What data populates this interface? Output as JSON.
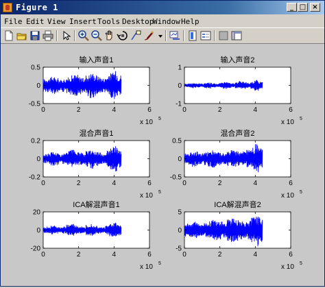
{
  "window": {
    "title": "Figure 1",
    "minimize_glyph": "_",
    "maximize_glyph": "□",
    "close_glyph": "×"
  },
  "menu": [
    "File",
    "Edit",
    "View",
    "Insert",
    "Tools",
    "Desktop",
    "Window",
    "Help"
  ],
  "toolbar": {
    "icons": [
      "new-figure-icon",
      "open-file-icon",
      "save-icon",
      "print-icon",
      "edit-plot-arrow-icon",
      "zoom-in-icon",
      "zoom-out-icon",
      "pan-icon",
      "rotate-3d-icon",
      "data-cursor-icon",
      "brush-icon",
      "link-plot-icon",
      "colorbar-icon",
      "legend-icon",
      "hide-plot-tools-icon",
      "show-plot-tools-icon"
    ]
  },
  "colors": {
    "signal": "#0000ff",
    "axes_bg": "#ffffff",
    "figure_bg": "#c8c8c8"
  },
  "chart_data": [
    {
      "type": "line",
      "title": "输入声音1",
      "xlim": [
        0,
        6
      ],
      "ylim": [
        -0.5,
        0.5
      ],
      "xticks": [
        "0",
        "2",
        "4",
        "6"
      ],
      "yticks": [
        "-0.5",
        "0",
        "0.5"
      ],
      "x_exponent": "x 10",
      "x_exponent_power": "5",
      "signal_x_range": [
        0,
        4.4
      ],
      "envelope": [
        0.18,
        0.2,
        0.25,
        0.2,
        0.15,
        0.18,
        0.22,
        0.28,
        0.3,
        0.25,
        0.2,
        0.3,
        0.35,
        0.3,
        0.25,
        0.2,
        0.25,
        0.35,
        0.4,
        0.3
      ]
    },
    {
      "type": "line",
      "title": "输入声音2",
      "xlim": [
        0,
        6
      ],
      "ylim": [
        -1,
        1
      ],
      "xticks": [
        "0",
        "2",
        "4",
        "6"
      ],
      "yticks": [
        "-1",
        "0",
        "1"
      ],
      "x_exponent": "x 10",
      "x_exponent_power": "5",
      "signal_x_range": [
        0,
        4.4
      ],
      "envelope": [
        0.1,
        0.12,
        0.15,
        0.12,
        0.1,
        0.15,
        0.18,
        0.12,
        0.1,
        0.15,
        0.2,
        0.15,
        0.12,
        0.18,
        0.25,
        0.2,
        0.15,
        0.2,
        0.3,
        0.2
      ]
    },
    {
      "type": "line",
      "title": "混合声音1",
      "xlim": [
        0,
        6
      ],
      "ylim": [
        -0.2,
        0.2
      ],
      "xticks": [
        "0",
        "2",
        "4",
        "6"
      ],
      "yticks": [
        "-0.2",
        "0",
        "0.2"
      ],
      "x_exponent": "x 10",
      "x_exponent_power": "5",
      "signal_x_range": [
        0,
        4.4
      ],
      "envelope": [
        0.05,
        0.06,
        0.08,
        0.07,
        0.05,
        0.06,
        0.09,
        0.1,
        0.08,
        0.07,
        0.06,
        0.09,
        0.11,
        0.08,
        0.07,
        0.06,
        0.09,
        0.12,
        0.14,
        0.1
      ]
    },
    {
      "type": "line",
      "title": "混合声音2",
      "xlim": [
        0,
        6
      ],
      "ylim": [
        -0.5,
        0.5
      ],
      "xticks": [
        "0",
        "2",
        "4",
        "6"
      ],
      "yticks": [
        "-0.5",
        "0",
        "0.5"
      ],
      "x_exponent": "x 10",
      "x_exponent_power": "5",
      "signal_x_range": [
        0,
        4.4
      ],
      "envelope": [
        0.15,
        0.18,
        0.22,
        0.2,
        0.15,
        0.18,
        0.22,
        0.25,
        0.2,
        0.18,
        0.15,
        0.2,
        0.25,
        0.22,
        0.18,
        0.2,
        0.25,
        0.3,
        0.4,
        0.3
      ]
    },
    {
      "type": "line",
      "title": "ICA解混声音1",
      "xlim": [
        0,
        6
      ],
      "ylim": [
        -20,
        20
      ],
      "xticks": [
        "0",
        "2",
        "4",
        "6"
      ],
      "yticks": [
        "-20",
        "0",
        "20"
      ],
      "x_exponent": "x 10",
      "x_exponent_power": "5",
      "signal_x_range": [
        0,
        4.4
      ],
      "envelope": [
        3,
        4,
        5,
        4,
        3,
        4,
        6,
        7,
        5,
        4,
        3,
        6,
        7,
        5,
        4,
        3,
        5,
        7,
        8,
        6
      ]
    },
    {
      "type": "line",
      "title": "ICA解混声音2",
      "xlim": [
        0,
        6
      ],
      "ylim": [
        -5,
        5
      ],
      "xticks": [
        "0",
        "2",
        "4",
        "6"
      ],
      "yticks": [
        "-5",
        "0",
        "5"
      ],
      "x_exponent": "x 10",
      "x_exponent_power": "5",
      "signal_x_range": [
        0,
        4.4
      ],
      "envelope": [
        1.8,
        2.0,
        2.5,
        2.2,
        1.8,
        2.0,
        2.4,
        2.8,
        3.0,
        2.6,
        2.2,
        3.0,
        3.4,
        3.0,
        2.6,
        2.2,
        2.6,
        3.5,
        4.5,
        3.5
      ]
    }
  ]
}
